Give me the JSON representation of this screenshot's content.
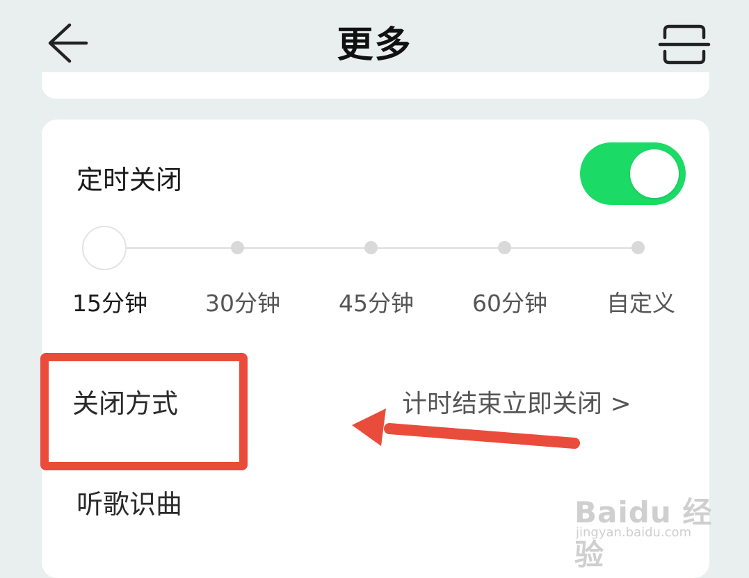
{
  "header": {
    "title": "更多"
  },
  "timer_section": {
    "label": "定时关闭",
    "toggle_on": true,
    "selected_index": 0,
    "options": [
      "15分钟",
      "30分钟",
      "45分钟",
      "60分钟",
      "自定义"
    ]
  },
  "close_mode": {
    "label": "关闭方式",
    "value": "计时结束立即关闭 >"
  },
  "song_recognition": {
    "label": "听歌识曲"
  },
  "colors": {
    "toggle_on": "#1bdb66",
    "annotation_red": "#ea4c3c",
    "background": "#e9eeee"
  },
  "watermark": {
    "brand": "Baidu 经验",
    "site": "jingyan.baidu.com"
  }
}
